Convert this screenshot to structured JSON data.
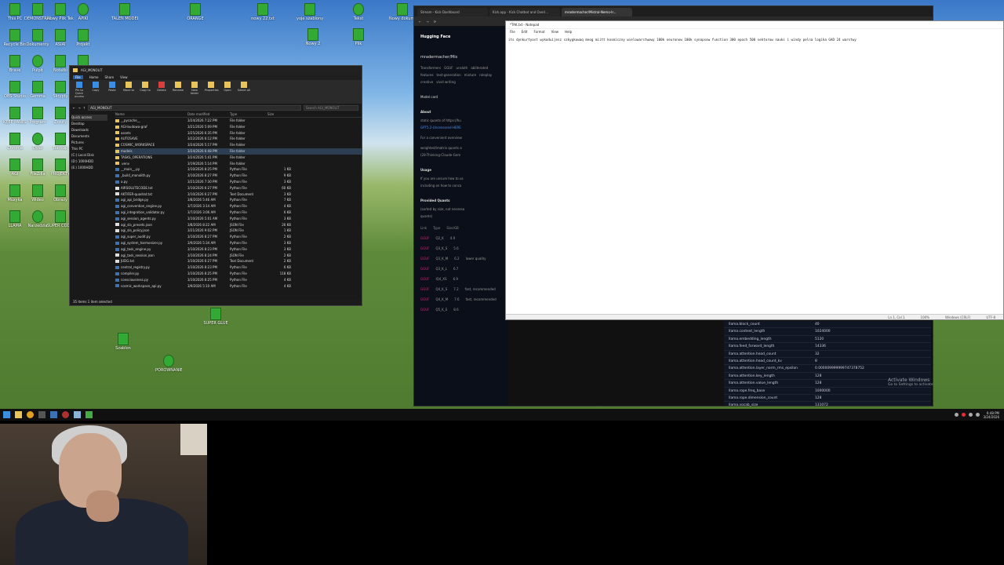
{
  "desktop": {
    "icons": [
      {
        "label": "This PC"
      },
      {
        "label": "DEMONSTRACJA"
      },
      {
        "label": "Nowy Plik Tekstowy"
      },
      {
        "label": "APIKI"
      },
      {
        "label": "Recycle Bin"
      },
      {
        "label": "Dokumenty"
      },
      {
        "label": "ASIAI"
      },
      {
        "label": "Projekt"
      },
      {
        "label": "Brave"
      },
      {
        "label": "Pulpit"
      },
      {
        "label": "Notatki"
      },
      {
        "label": "MODELE"
      },
      {
        "label": "OBS Studio"
      },
      {
        "label": "Gemma"
      },
      {
        "label": "Skrypty"
      },
      {
        "label": "Nowy Folder"
      },
      {
        "label": "KEEP PANEL"
      },
      {
        "label": "Program"
      },
      {
        "label": "Zrzuty"
      },
      {
        "label": "Eksport"
      },
      {
        "label": "Chrome"
      },
      {
        "label": "Dysk"
      },
      {
        "label": "Backup"
      },
      {
        "label": "Ustawienia"
      },
      {
        "label": "AGI"
      },
      {
        "label": "FileZilla"
      },
      {
        "label": "PROJEKTY"
      },
      {
        "label": "Kod"
      },
      {
        "label": "Muzyka"
      },
      {
        "label": "Wideo"
      },
      {
        "label": "Obrazy"
      },
      {
        "label": "Pliki"
      },
      {
        "label": "LLAMA"
      },
      {
        "label": "Narzedzia"
      },
      {
        "label": "SUPER CODER"
      },
      {
        "label": "Nowy"
      }
    ],
    "top_icons": [
      {
        "label": "TALEN MODEL"
      },
      {
        "label": "ORANGE"
      },
      {
        "label": "nowy 22.txt"
      },
      {
        "label": "yoje szablony"
      },
      {
        "label": "Tekst"
      },
      {
        "label": "Nowy dokument"
      },
      {
        "label": "Nowy 2"
      },
      {
        "label": "Plik"
      }
    ],
    "bottom_icons": [
      {
        "label": "SUPER GLUE"
      },
      {
        "label": "Szablon"
      },
      {
        "label": "PORÓWNANIE RQ.LANG"
      }
    ]
  },
  "explorer": {
    "title": "AGI_MONOLIT",
    "ribbon_tabs": [
      "File",
      "Home",
      "Share",
      "View"
    ],
    "ribbon_buttons": [
      {
        "label": "Pin to Quick access",
        "icon": "pin-icon"
      },
      {
        "label": "Copy",
        "icon": "copy-icon"
      },
      {
        "label": "Paste",
        "icon": "paste-icon"
      },
      {
        "label": "Move to",
        "icon": "move-icon"
      },
      {
        "label": "Copy to",
        "icon": "copy-to-icon"
      },
      {
        "label": "Delete",
        "icon": "delete-icon"
      },
      {
        "label": "Rename",
        "icon": "rename-icon"
      },
      {
        "label": "New folder",
        "icon": "new-folder-icon"
      },
      {
        "label": "Properties",
        "icon": "properties-icon"
      },
      {
        "label": "Open",
        "icon": "open-icon"
      },
      {
        "label": "Select all",
        "icon": "select-icon"
      }
    ],
    "address": "AGI_MONOLIT",
    "search_placeholder": "Search AGI_MONOLIT",
    "nav": [
      "Quick access",
      "Desktop",
      "Downloads",
      "Documents",
      "Pictures",
      "This PC",
      "(C:) Local Disk",
      "(D:) 1000HDD",
      "(E:) 1000HDD"
    ],
    "columns": [
      "Name",
      "Date modified",
      "Type",
      "Size"
    ],
    "files": [
      {
        "name": "__pycache__",
        "date": "3/24/2026 7:22 PM",
        "type": "File folder",
        "size": "",
        "kind": "folder"
      },
      {
        "name": "AGI-budowa-graf",
        "date": "3/21/2026 5:09 PM",
        "type": "File folder",
        "size": "",
        "kind": "folder"
      },
      {
        "name": "assets",
        "date": "3/25/2026 6:35 PM",
        "type": "File folder",
        "size": "",
        "kind": "folder"
      },
      {
        "name": "AUTOSAVE",
        "date": "3/22/2026 6:12 PM",
        "type": "File folder",
        "size": "",
        "kind": "folder"
      },
      {
        "name": "COSMIC_WORKSPACE",
        "date": "3/24/2026 5:17 PM",
        "type": "File folder",
        "size": "",
        "kind": "folder"
      },
      {
        "name": "models",
        "date": "3/24/2026 6:48 PM",
        "type": "File folder",
        "size": "",
        "kind": "folder"
      },
      {
        "name": "TASKS_OPERATIONS",
        "date": "3/24/2026 5:41 PM",
        "type": "File folder",
        "size": "",
        "kind": "folder"
      },
      {
        "name": ".venv",
        "date": "3/19/2026 5:14 PM",
        "type": "File folder",
        "size": "",
        "kind": "folder"
      },
      {
        "name": "__main__.py",
        "date": "3/10/2026 8:25 PM",
        "type": "Python File",
        "size": "1 KB",
        "kind": "py"
      },
      {
        "name": "_build_monolith.py",
        "date": "3/10/2026 8:27 PM",
        "type": "Python File",
        "size": "9 KB",
        "kind": "py"
      },
      {
        "name": "a.py",
        "date": "3/21/2026 7:30 PM",
        "type": "Python File",
        "size": "3 KB",
        "kind": "py"
      },
      {
        "name": "AIRSOLUTECODE.txt",
        "date": "3/10/2026 6:27 PM",
        "type": "Python File",
        "size": "60 KB",
        "kind": "doc"
      },
      {
        "name": "AKTIFER-quadrat.txt",
        "date": "3/10/2026 6:27 PM",
        "type": "Text Document",
        "size": "3 KB",
        "kind": "doc"
      },
      {
        "name": "agi_api_bridge.py",
        "date": "3/8/2026 5:46 AM",
        "type": "Python File",
        "size": "7 KB",
        "kind": "py"
      },
      {
        "name": "agi_convention_engine.py",
        "date": "3/7/2026 3:14 AM",
        "type": "Python File",
        "size": "4 KB",
        "kind": "py"
      },
      {
        "name": "agi_integration_validator.py",
        "date": "3/7/2026 3:06 AM",
        "type": "Python File",
        "size": "6 KB",
        "kind": "py"
      },
      {
        "name": "agi_session_agents.py",
        "date": "3/10/2026 5:01 AM",
        "type": "Python File",
        "size": "3 KB",
        "kind": "py"
      },
      {
        "name": "agi_sla_presets.json",
        "date": "3/8/2026 8:22 AM",
        "type": "JSON File",
        "size": "26 KB",
        "kind": "doc"
      },
      {
        "name": "agi_sla_policy.json",
        "date": "3/21/2026 9:02 PM",
        "type": "JSON File",
        "size": "1 KB",
        "kind": "doc"
      },
      {
        "name": "agi_super_audit.py",
        "date": "3/10/2026 8:27 PM",
        "type": "Python File",
        "size": "2 KB",
        "kind": "py"
      },
      {
        "name": "agi_system_harmonizer.py",
        "date": "3/9/2026 5:34 AM",
        "type": "Python File",
        "size": "3 KB",
        "kind": "py"
      },
      {
        "name": "agi_task_engine.py",
        "date": "3/10/2026 8:23 PM",
        "type": "Python File",
        "size": "3 KB",
        "kind": "py"
      },
      {
        "name": "agi_task_session.json",
        "date": "3/10/2026 8:24 PM",
        "type": "JSON File",
        "size": "2 KB",
        "kind": "doc"
      },
      {
        "name": "JUDG.txt",
        "date": "3/10/2026 6:27 PM",
        "type": "Text Document",
        "size": "2 KB",
        "kind": "doc"
      },
      {
        "name": "central_registry.py",
        "date": "3/10/2026 8:23 PM",
        "type": "Python File",
        "size": "6 KB",
        "kind": "py"
      },
      {
        "name": "compiler.py",
        "date": "3/10/2026 8:25 PM",
        "type": "Python File",
        "size": "118 KB",
        "kind": "py"
      },
      {
        "name": "consciousness.py",
        "date": "3/10/2026 8:25 PM",
        "type": "Python File",
        "size": "4 KB",
        "kind": "py"
      },
      {
        "name": "cosmic_workspace_api.py",
        "date": "3/9/2026 5:10 AM",
        "type": "Python File",
        "size": "4 KB",
        "kind": "py"
      }
    ],
    "status": "35 items   1 item selected"
  },
  "browser": {
    "tabs": [
      {
        "label": "Stream - Kick Dashboard"
      },
      {
        "label": "Kick.app - Kick Chatbot and Overl..."
      },
      {
        "label": "mradermacher/Mistral-Nemo-Ir..."
      }
    ],
    "hf": {
      "logo": "Hugging Face",
      "repo": "mradermacher/Mis",
      "tags": [
        "Transformers",
        "GGUF",
        "unsloth",
        "abliterated",
        "features",
        "text-generation",
        "mixture",
        "roleplay",
        "creative",
        "vivid writing"
      ],
      "model_card": "Model card",
      "about_title": "About",
      "about_text": "static quants of https://hu",
      "about_text2": "GPT5.2-Uncensored-HERE",
      "convenient": "For a convenient overview",
      "weighted": "weighted/imatrix quants a",
      "thinking": "(28-Thinking-Claude-Gem",
      "usage_title": "Usage",
      "usage_text": "If you are unsure how to us",
      "usage_text2": "including on how to conca",
      "provided_title": "Provided Quants",
      "provided_text": "(sorted by size, not necessa",
      "provided_text2": "quants)",
      "quant_header": [
        "Link",
        "Type",
        "Size/GB",
        "Notes"
      ],
      "quants": [
        {
          "link": "GGUF",
          "type": "Q2_K",
          "size": "4.9",
          "note": ""
        },
        {
          "link": "GGUF",
          "type": "Q3_K_S",
          "size": "5.6",
          "note": ""
        },
        {
          "link": "GGUF",
          "type": "Q3_K_M",
          "size": "6.2",
          "note": "lower quality"
        },
        {
          "link": "GGUF",
          "type": "Q3_K_L",
          "size": "6.7",
          "note": ""
        },
        {
          "link": "GGUF",
          "type": "IQ4_XS",
          "size": "6.9",
          "note": ""
        },
        {
          "link": "GGUF",
          "type": "Q4_K_S",
          "size": "7.2",
          "note": "fast, recommended"
        },
        {
          "link": "GGUF",
          "type": "Q4_K_M",
          "size": "7.6",
          "note": "fast, recommended"
        },
        {
          "link": "GGUF",
          "type": "Q5_K_S",
          "size": "8.6",
          "note": ""
        }
      ]
    }
  },
  "notepad": {
    "title": "*TAK.txt - Notepad",
    "menu": [
      "File",
      "Edit",
      "Format",
      "View",
      "Help"
    ],
    "text": "its dynkurtyost wykoduijesz szkygkowaq meog miitt kosmiczny wielowarstwowy 100k neuronow 100k synapsow function 300 epoch 500 sektorow nauki i windy pelna logika GAD 24 warstwy",
    "status": [
      "Ln 1, Col 1",
      "100%",
      "Windows (CRLF)",
      "UTF-8"
    ]
  },
  "params": [
    {
      "key": "llama.block_count",
      "value": "40"
    },
    {
      "key": "llama.context_length",
      "value": "1024000"
    },
    {
      "key": "llama.embedding_length",
      "value": "5120"
    },
    {
      "key": "llama.feed_forward_length",
      "value": "14336"
    },
    {
      "key": "llama.attention.head_count",
      "value": "32"
    },
    {
      "key": "llama.attention.head_count_kv",
      "value": "8"
    },
    {
      "key": "llama.attention.layer_norm_rms_epsilon",
      "value": "0.000009999999747378752"
    },
    {
      "key": "llama.attention.key_length",
      "value": "128"
    },
    {
      "key": "llama.attention.value_length",
      "value": "128"
    },
    {
      "key": "llama.rope.freq_base",
      "value": "1000000"
    },
    {
      "key": "llama.rope.dimension_count",
      "value": "128"
    },
    {
      "key": "llama.vocab_size",
      "value": "131072"
    }
  ],
  "activate": {
    "title": "Activate Windows",
    "sub": "Go to Settings to activate"
  },
  "taskbar": {
    "clock_time": "6:48 PM",
    "clock_date": "3/24/2026"
  }
}
